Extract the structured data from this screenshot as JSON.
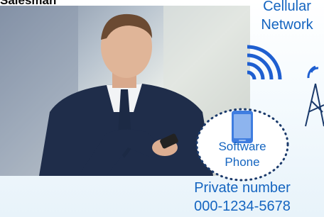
{
  "title_partial": "Salesman",
  "cellular": {
    "line1": "Cellular",
    "line2": "Network"
  },
  "phone": {
    "line1": "Software",
    "line2": "Phone"
  },
  "private": {
    "line1": "Private number",
    "line2": "000-1234-5678"
  },
  "colors": {
    "accent": "#1565c0",
    "wave": "#1f5fd0",
    "circle_dots": "#1b3a6b"
  },
  "icons": [
    "cellular-waves-icon",
    "smartphone-icon",
    "cell-tower-icon"
  ]
}
